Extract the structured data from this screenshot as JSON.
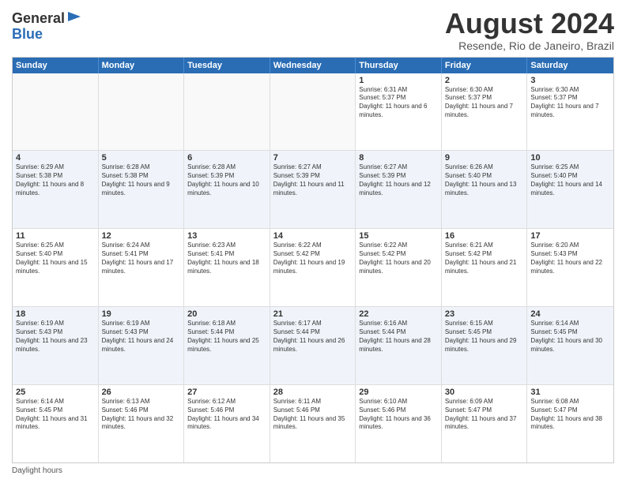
{
  "logo": {
    "general": "General",
    "blue": "Blue"
  },
  "title": "August 2024",
  "subtitle": "Resende, Rio de Janeiro, Brazil",
  "headers": [
    "Sunday",
    "Monday",
    "Tuesday",
    "Wednesday",
    "Thursday",
    "Friday",
    "Saturday"
  ],
  "footer": "Daylight hours",
  "weeks": [
    [
      {
        "day": "",
        "info": ""
      },
      {
        "day": "",
        "info": ""
      },
      {
        "day": "",
        "info": ""
      },
      {
        "day": "",
        "info": ""
      },
      {
        "day": "1",
        "info": "Sunrise: 6:31 AM\nSunset: 5:37 PM\nDaylight: 11 hours and 6 minutes."
      },
      {
        "day": "2",
        "info": "Sunrise: 6:30 AM\nSunset: 5:37 PM\nDaylight: 11 hours and 7 minutes."
      },
      {
        "day": "3",
        "info": "Sunrise: 6:30 AM\nSunset: 5:37 PM\nDaylight: 11 hours and 7 minutes."
      }
    ],
    [
      {
        "day": "4",
        "info": "Sunrise: 6:29 AM\nSunset: 5:38 PM\nDaylight: 11 hours and 8 minutes."
      },
      {
        "day": "5",
        "info": "Sunrise: 6:28 AM\nSunset: 5:38 PM\nDaylight: 11 hours and 9 minutes."
      },
      {
        "day": "6",
        "info": "Sunrise: 6:28 AM\nSunset: 5:39 PM\nDaylight: 11 hours and 10 minutes."
      },
      {
        "day": "7",
        "info": "Sunrise: 6:27 AM\nSunset: 5:39 PM\nDaylight: 11 hours and 11 minutes."
      },
      {
        "day": "8",
        "info": "Sunrise: 6:27 AM\nSunset: 5:39 PM\nDaylight: 11 hours and 12 minutes."
      },
      {
        "day": "9",
        "info": "Sunrise: 6:26 AM\nSunset: 5:40 PM\nDaylight: 11 hours and 13 minutes."
      },
      {
        "day": "10",
        "info": "Sunrise: 6:25 AM\nSunset: 5:40 PM\nDaylight: 11 hours and 14 minutes."
      }
    ],
    [
      {
        "day": "11",
        "info": "Sunrise: 6:25 AM\nSunset: 5:40 PM\nDaylight: 11 hours and 15 minutes."
      },
      {
        "day": "12",
        "info": "Sunrise: 6:24 AM\nSunset: 5:41 PM\nDaylight: 11 hours and 17 minutes."
      },
      {
        "day": "13",
        "info": "Sunrise: 6:23 AM\nSunset: 5:41 PM\nDaylight: 11 hours and 18 minutes."
      },
      {
        "day": "14",
        "info": "Sunrise: 6:22 AM\nSunset: 5:42 PM\nDaylight: 11 hours and 19 minutes."
      },
      {
        "day": "15",
        "info": "Sunrise: 6:22 AM\nSunset: 5:42 PM\nDaylight: 11 hours and 20 minutes."
      },
      {
        "day": "16",
        "info": "Sunrise: 6:21 AM\nSunset: 5:42 PM\nDaylight: 11 hours and 21 minutes."
      },
      {
        "day": "17",
        "info": "Sunrise: 6:20 AM\nSunset: 5:43 PM\nDaylight: 11 hours and 22 minutes."
      }
    ],
    [
      {
        "day": "18",
        "info": "Sunrise: 6:19 AM\nSunset: 5:43 PM\nDaylight: 11 hours and 23 minutes."
      },
      {
        "day": "19",
        "info": "Sunrise: 6:19 AM\nSunset: 5:43 PM\nDaylight: 11 hours and 24 minutes."
      },
      {
        "day": "20",
        "info": "Sunrise: 6:18 AM\nSunset: 5:44 PM\nDaylight: 11 hours and 25 minutes."
      },
      {
        "day": "21",
        "info": "Sunrise: 6:17 AM\nSunset: 5:44 PM\nDaylight: 11 hours and 26 minutes."
      },
      {
        "day": "22",
        "info": "Sunrise: 6:16 AM\nSunset: 5:44 PM\nDaylight: 11 hours and 28 minutes."
      },
      {
        "day": "23",
        "info": "Sunrise: 6:15 AM\nSunset: 5:45 PM\nDaylight: 11 hours and 29 minutes."
      },
      {
        "day": "24",
        "info": "Sunrise: 6:14 AM\nSunset: 5:45 PM\nDaylight: 11 hours and 30 minutes."
      }
    ],
    [
      {
        "day": "25",
        "info": "Sunrise: 6:14 AM\nSunset: 5:45 PM\nDaylight: 11 hours and 31 minutes."
      },
      {
        "day": "26",
        "info": "Sunrise: 6:13 AM\nSunset: 5:46 PM\nDaylight: 11 hours and 32 minutes."
      },
      {
        "day": "27",
        "info": "Sunrise: 6:12 AM\nSunset: 5:46 PM\nDaylight: 11 hours and 34 minutes."
      },
      {
        "day": "28",
        "info": "Sunrise: 6:11 AM\nSunset: 5:46 PM\nDaylight: 11 hours and 35 minutes."
      },
      {
        "day": "29",
        "info": "Sunrise: 6:10 AM\nSunset: 5:46 PM\nDaylight: 11 hours and 36 minutes."
      },
      {
        "day": "30",
        "info": "Sunrise: 6:09 AM\nSunset: 5:47 PM\nDaylight: 11 hours and 37 minutes."
      },
      {
        "day": "31",
        "info": "Sunrise: 6:08 AM\nSunset: 5:47 PM\nDaylight: 11 hours and 38 minutes."
      }
    ]
  ]
}
